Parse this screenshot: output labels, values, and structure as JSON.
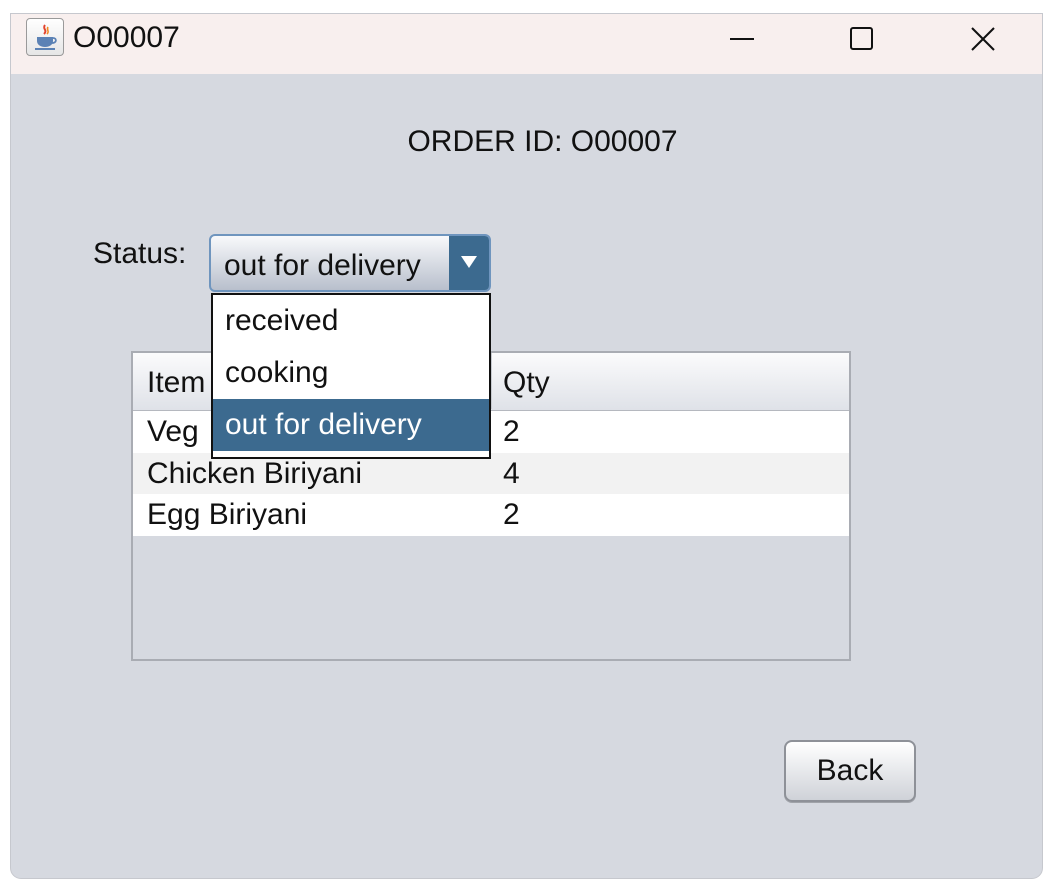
{
  "window": {
    "title": "O00007",
    "icon": "java-cup-icon",
    "controls": [
      "minimize-icon",
      "maximize-icon",
      "close-icon"
    ]
  },
  "order": {
    "title": "ORDER ID: O00007"
  },
  "status": {
    "label": "Status:",
    "selected": "out for delivery",
    "options": [
      "received",
      "cooking",
      "out for delivery"
    ]
  },
  "table": {
    "headers": {
      "item": "Item",
      "qty": "Qty"
    },
    "rows": [
      {
        "item": "Veg",
        "qty": "2"
      },
      {
        "item": "Chicken Biriyani",
        "qty": "4"
      },
      {
        "item": "Egg Biriyani",
        "qty": "2"
      }
    ]
  },
  "actions": {
    "back_label": "Back"
  },
  "colors": {
    "window_bg": "#d6d9e0",
    "titlebar_bg": "#f8efee",
    "selection": "#3c6a8f"
  }
}
